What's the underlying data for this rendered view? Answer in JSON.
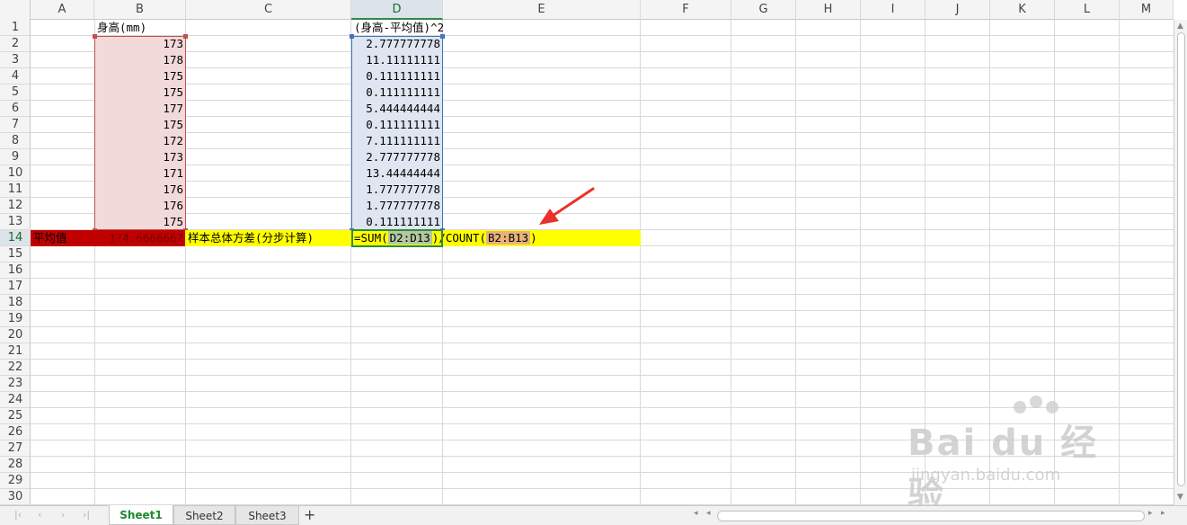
{
  "columns": [
    "A",
    "B",
    "C",
    "D",
    "E",
    "F",
    "G",
    "H",
    "I",
    "J",
    "K",
    "L",
    "M"
  ],
  "rows": [
    "1",
    "2",
    "3",
    "4",
    "5",
    "6",
    "7",
    "8",
    "9",
    "10",
    "11",
    "12",
    "13",
    "14",
    "15",
    "16",
    "17",
    "18",
    "19",
    "20",
    "21",
    "22",
    "23",
    "24",
    "25",
    "26",
    "27",
    "28",
    "29",
    "30"
  ],
  "active_column": "D",
  "active_row": "14",
  "cells": {
    "B1": "身高(mm)",
    "D1": "(身高-平均值)^2",
    "B_values": [
      "173",
      "178",
      "175",
      "175",
      "177",
      "175",
      "172",
      "173",
      "171",
      "176",
      "176",
      "175"
    ],
    "D_values": [
      "2.777777778",
      "11.11111111",
      "0.111111111",
      "0.111111111",
      "5.444444444",
      "0.111111111",
      "7.111111111",
      "2.777777778",
      "13.44444444",
      "1.777777778",
      "1.777777778",
      "0.111111111"
    ],
    "A14": "平均值",
    "B14": "174.6666667",
    "C14": "样本总体方差(分步计算)",
    "D14_formula_prefix": "=SUM(",
    "D14_range1": "D2:D13",
    "D14_formula_mid": ")/COUNT(",
    "D14_range2": "B2:B13",
    "D14_formula_suffix": ")"
  },
  "highlight_colors": {
    "avg_fill": "#c00000",
    "formula_fill": "#ffff00",
    "range_b": "#c0504d",
    "range_d": "#4472c4",
    "arrow": "#e8322b"
  },
  "sheets": [
    "Sheet1",
    "Sheet2",
    "Sheet3"
  ],
  "active_sheet": "Sheet1",
  "add_sheet_symbol": "+",
  "watermark": {
    "logo_text": "Bai du 经验",
    "url_text": "jingyan.baidu.com"
  }
}
